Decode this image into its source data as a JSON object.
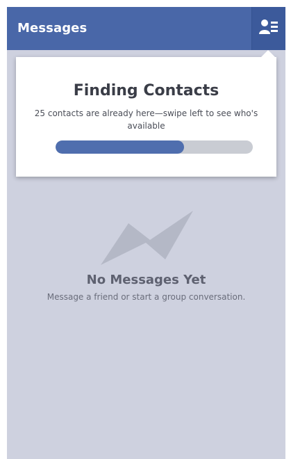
{
  "header": {
    "title": "Messages",
    "contacts_icon": "contacts-list-icon"
  },
  "finding_contacts": {
    "title": "Finding Contacts",
    "message": "25 contacts are already here—swipe left to see who's available",
    "progress": 0.65
  },
  "empty_state": {
    "icon": "messenger-logo-icon",
    "title": "No Messages Yet",
    "subtitle": "Message a friend or start a group conversation."
  },
  "colors": {
    "header_background": "#4967a8",
    "screen_background": "#ced1df",
    "progress_fill": "#4f6eae",
    "progress_track": "#c9ccd3"
  }
}
